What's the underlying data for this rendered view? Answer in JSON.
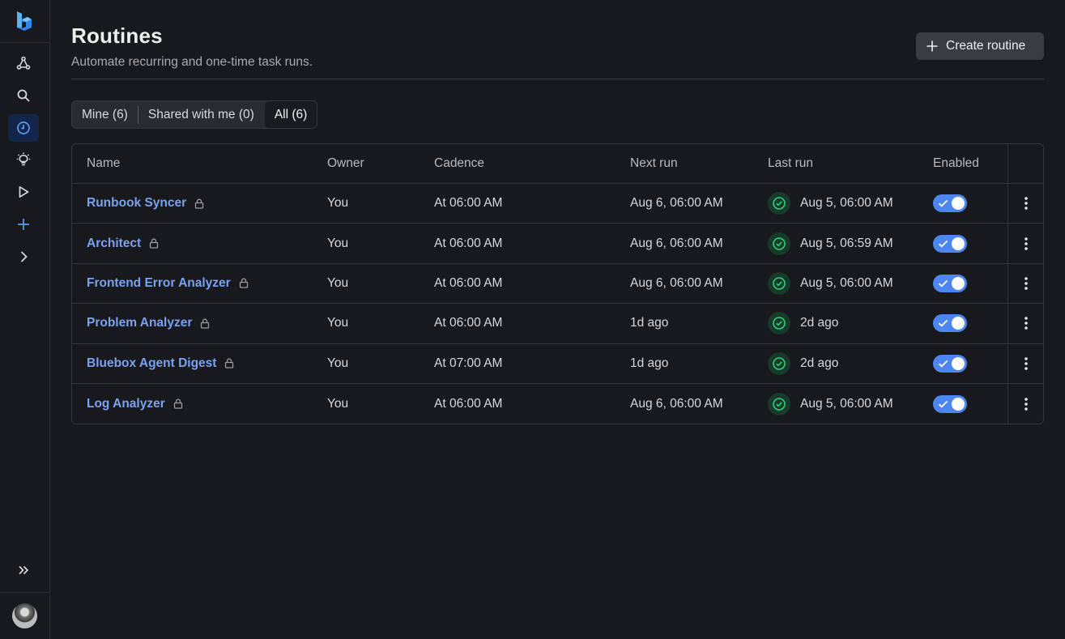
{
  "page": {
    "title": "Routines",
    "subtitle": "Automate recurring and one-time task runs.",
    "create_button": "Create routine"
  },
  "sidebar": {
    "items": [
      {
        "icon": "workflow-icon"
      },
      {
        "icon": "search-icon"
      },
      {
        "icon": "clock-icon",
        "active": true
      },
      {
        "icon": "lightbulb-icon"
      },
      {
        "icon": "play-icon"
      },
      {
        "icon": "plus-icon"
      },
      {
        "icon": "chevron-right-icon"
      }
    ],
    "expand_icon": "double-chevron-right-icon"
  },
  "filters": {
    "mine": "Mine (6)",
    "shared": "Shared with me (0)",
    "all": "All (6)",
    "selected": "All (6)"
  },
  "table": {
    "headers": {
      "name": "Name",
      "owner": "Owner",
      "cadence": "Cadence",
      "next_run": "Next run",
      "last_run": "Last run",
      "enabled": "Enabled"
    },
    "rows": [
      {
        "name": "Runbook Syncer",
        "owner": "You",
        "cadence": "At 06:00 AM",
        "next_run": "Aug 6, 06:00 AM",
        "last_run": "Aug 5, 06:00 AM",
        "enabled": true
      },
      {
        "name": "Architect",
        "owner": "You",
        "cadence": "At 06:00 AM",
        "next_run": "Aug 6, 06:00 AM",
        "last_run": "Aug 5, 06:59 AM",
        "enabled": true
      },
      {
        "name": "Frontend Error Analyzer",
        "owner": "You",
        "cadence": "At 06:00 AM",
        "next_run": "Aug 6, 06:00 AM",
        "last_run": "Aug 5, 06:00 AM",
        "enabled": true
      },
      {
        "name": "Problem Analyzer",
        "owner": "You",
        "cadence": "At 06:00 AM",
        "next_run": "1d ago",
        "last_run": "2d ago",
        "enabled": true
      },
      {
        "name": "Bluebox Agent Digest",
        "owner": "You",
        "cadence": "At 07:00 AM",
        "next_run": "1d ago",
        "last_run": "2d ago",
        "enabled": true
      },
      {
        "name": "Log Analyzer",
        "owner": "You",
        "cadence": "At 06:00 AM",
        "next_run": "Aug 6, 06:00 AM",
        "last_run": "Aug 5, 06:00 AM",
        "enabled": true
      }
    ]
  },
  "colors": {
    "accent": "#4d86f0",
    "link": "#7aa2f0",
    "success": "#2fd07a",
    "background": "#18191d"
  }
}
